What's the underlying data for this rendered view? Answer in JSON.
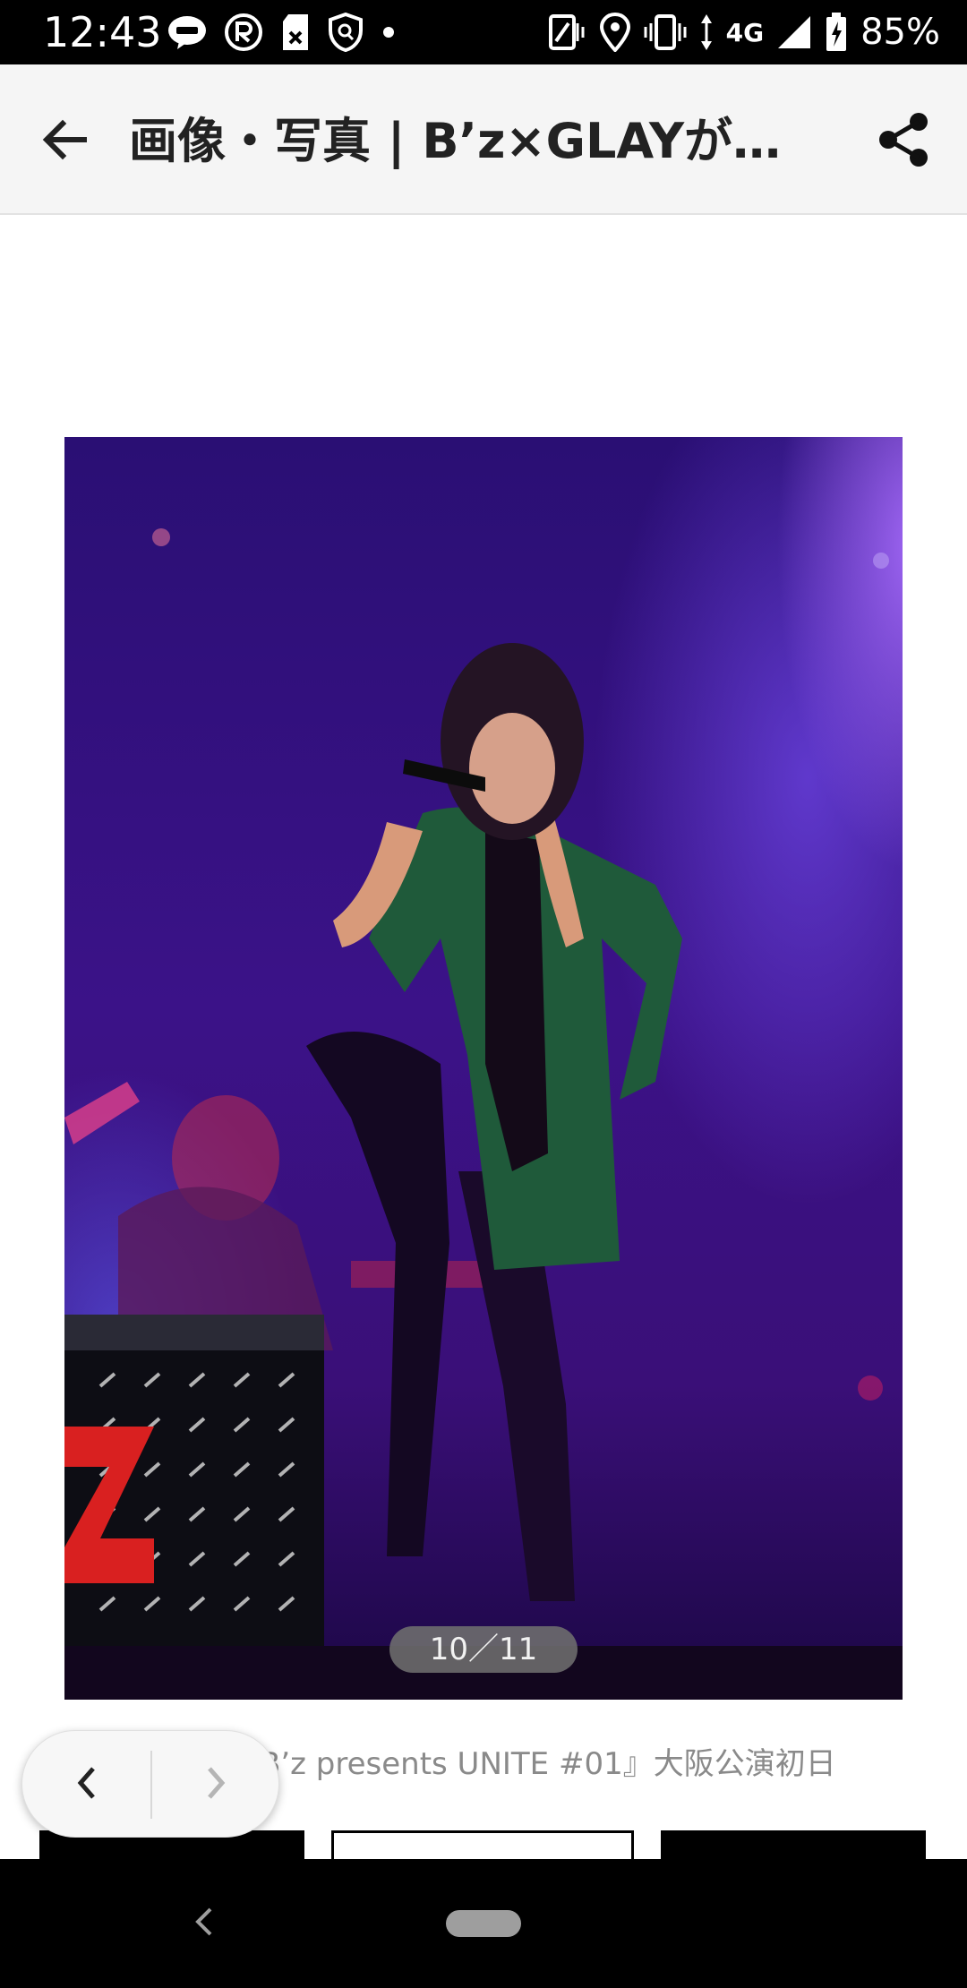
{
  "status_bar": {
    "time": "12:43",
    "network": "4G",
    "battery": "85%",
    "icons": [
      "line-icon",
      "r-app-icon",
      "sd-card-icon",
      "shield-icon",
      "dot-icon",
      "nfc-icon",
      "location-icon",
      "vibrate-icon",
      "data-arrows-icon",
      "signal-icon",
      "battery-icon"
    ]
  },
  "app_bar": {
    "title": "画像・写真 | B’z×GLAYが初…",
    "back_icon": "arrow-left-icon",
    "share_icon": "share-icon"
  },
  "gallery": {
    "page_indicator": "10／11",
    "caption": "B’z presents UNITE #01』大阪公演初日"
  },
  "nav_pill": {
    "prev_icon": "chevron-left-icon",
    "next_icon": "chevron-right-icon"
  },
  "system_nav": {
    "back_icon": "system-back-icon",
    "home_icon": "home-pill-icon"
  },
  "colors": {
    "status_bar_bg": "#000000",
    "app_bar_bg": "#f5f5f5",
    "photo_purple": "#3b1288",
    "indicator_bg": "#6e6e6e"
  }
}
